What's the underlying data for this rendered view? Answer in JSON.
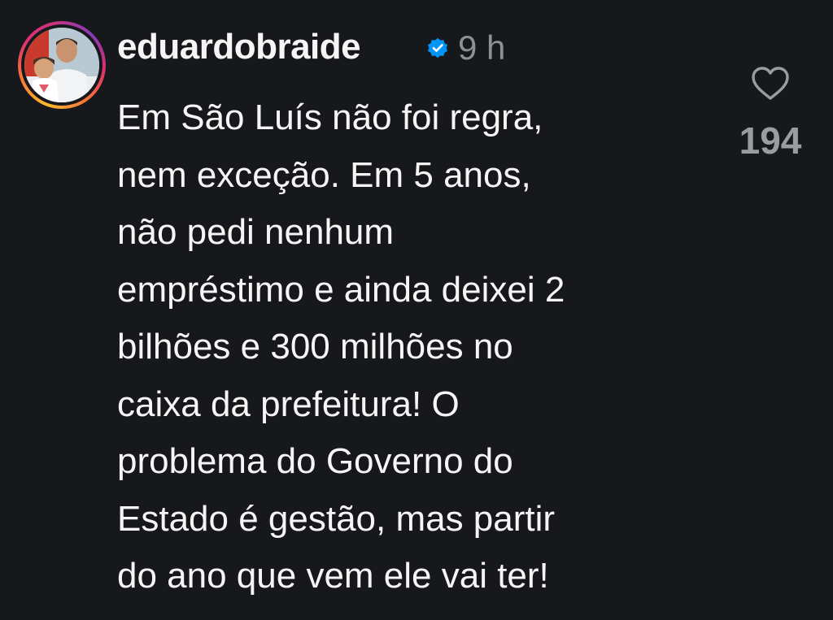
{
  "comment": {
    "username": "eduardobraide",
    "verified": true,
    "timestamp": "9 h",
    "text_lines": [
      "Em São Luís não foi regra,",
      "nem exceção. Em 5 anos,",
      "não pedi nenhum",
      "empréstimo e ainda deixei 2",
      "bilhões e 300 milhões no",
      "caixa da prefeitura! O",
      "problema do Governo do",
      "Estado é gestão, mas partir",
      "do ano que vem ele vai ter!"
    ],
    "like_count": "194"
  },
  "icons": {
    "verified": "verified-badge-icon",
    "like": "heart-outline-icon"
  },
  "colors": {
    "background": "#17181b",
    "text": "#f5f5f5",
    "muted": "#8e9096",
    "verified_blue": "#0095f6"
  }
}
